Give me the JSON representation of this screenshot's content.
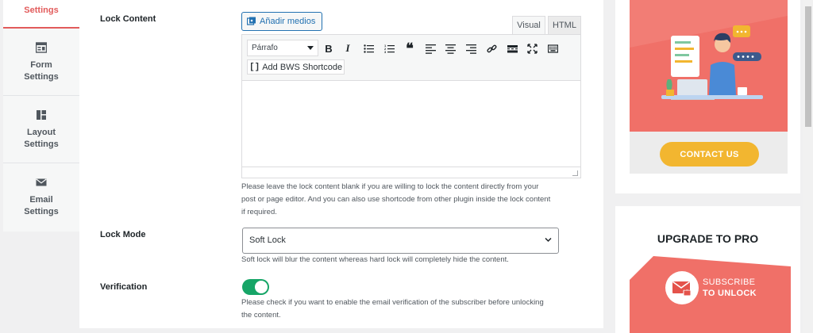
{
  "tabs": [
    {
      "label": "Settings",
      "icon": "settings-icon"
    },
    {
      "label": "Form Settings",
      "line1": "Form",
      "line2": "Settings",
      "icon": "form-icon"
    },
    {
      "label": "Layout Settings",
      "line1": "Layout",
      "line2": "Settings",
      "icon": "layout-icon"
    },
    {
      "label": "Email Settings",
      "line1": "Email",
      "line2": "Settings",
      "icon": "envelope-icon"
    }
  ],
  "lock_content": {
    "label": "Lock Content",
    "add_media": "Añadir medios",
    "mode_visual": "Visual",
    "mode_html": "HTML",
    "format_select": "Párrafo",
    "bws_shortcode": "Add BWS Shortcode",
    "help_line1": "Please leave the lock content blank if you are willing to lock the content directly from your",
    "help_line2": "post or page editor. And you can also use shortcode from other plugin inside the lock content",
    "help_line3": "if required."
  },
  "lock_mode": {
    "label": "Lock Mode",
    "value": "Soft Lock",
    "help": "Soft lock will blur the content whereas hard lock will completely hide the content."
  },
  "verification": {
    "label": "Verification",
    "enabled": true,
    "help_line1": "Please check if you want to enable the email verification of the subscriber before unlocking",
    "help_line2": "the content."
  },
  "promo_contact": {
    "button": "CONTACT US"
  },
  "promo_upgrade": {
    "title": "UPGRADE TO PRO",
    "line1": "SUBSCRIBE",
    "line2": "TO UNLOCK"
  },
  "colors": {
    "accent": "#e25b5b",
    "toggle_on": "#16a567",
    "promo_red": "#f07068",
    "contact_yellow": "#f2b630"
  }
}
